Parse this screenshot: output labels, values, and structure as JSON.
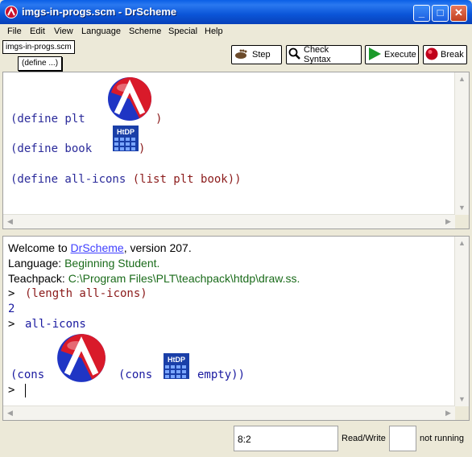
{
  "window": {
    "title": "imgs-in-progs.scm - DrScheme"
  },
  "menu": [
    "File",
    "Edit",
    "View",
    "Language",
    "Scheme",
    "Special",
    "Help"
  ],
  "toolbar": {
    "file_label": "imgs-in-progs.scm",
    "define_label": "(define ...)",
    "step": "Step",
    "check_syntax": "Check Syntax",
    "execute": "Execute",
    "break": "Break"
  },
  "definitions": {
    "line1_prefix": "(define plt",
    "line1_close": ")",
    "line2_prefix": "(define book",
    "line2_close": ")",
    "line3_prefix": "(define all-icons",
    "line3_inner": "(list plt book)",
    "line3_close": ")"
  },
  "interactions": {
    "welcome_pre": "Welcome to ",
    "welcome_link": "DrScheme",
    "welcome_post": ", version 207.",
    "language_label": "Language: ",
    "language_value": "Beginning Student",
    "language_dot": ".",
    "teachpack_label": "Teachpack: ",
    "teachpack_value": "C:\\Program Files\\PLT\\teachpack\\htdp\\draw.ss",
    "teachpack_dot": ".",
    "prompt1": ">",
    "expr1": "(length all-icons)",
    "result1": "2",
    "prompt2": ">",
    "expr2": "all-icons",
    "result2_a": "(cons",
    "result2_b": "(cons",
    "result2_c": "empty))",
    "prompt3": ">"
  },
  "icons": {
    "plt_logo": "plt-logo-icon",
    "htdp_logo": "htdp-book-icon"
  },
  "status": {
    "position": "8:2",
    "mode": "Read/Write",
    "running": "not running"
  }
}
